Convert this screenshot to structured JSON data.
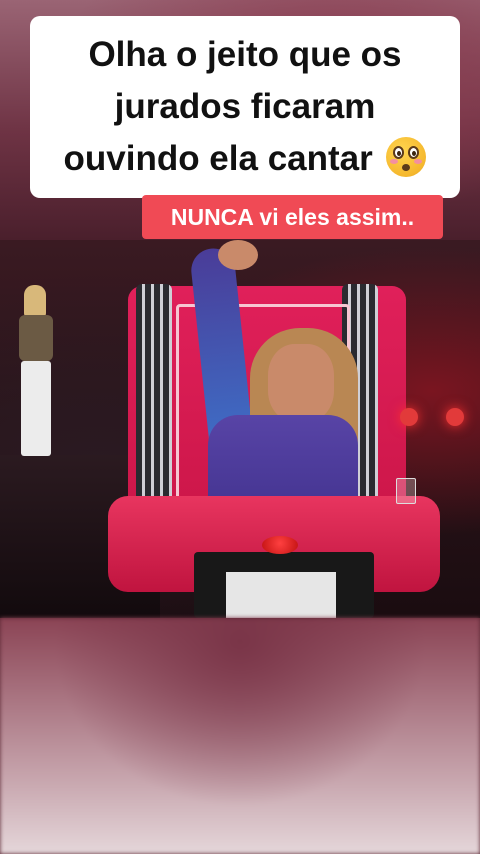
{
  "caption": {
    "line1": "Olha o jeito que os",
    "line2": "jurados ficaram",
    "line3": "ouvindo ela cantar",
    "emoji": "flushed-face-emoji"
  },
  "subtitle": "NUNCA vi eles assim..",
  "colors": {
    "caption_bg": "#ffffff",
    "caption_text": "#111111",
    "subtitle_bg": "#f04a55",
    "subtitle_text": "#ffffff",
    "chair_red": "#d0174b"
  }
}
